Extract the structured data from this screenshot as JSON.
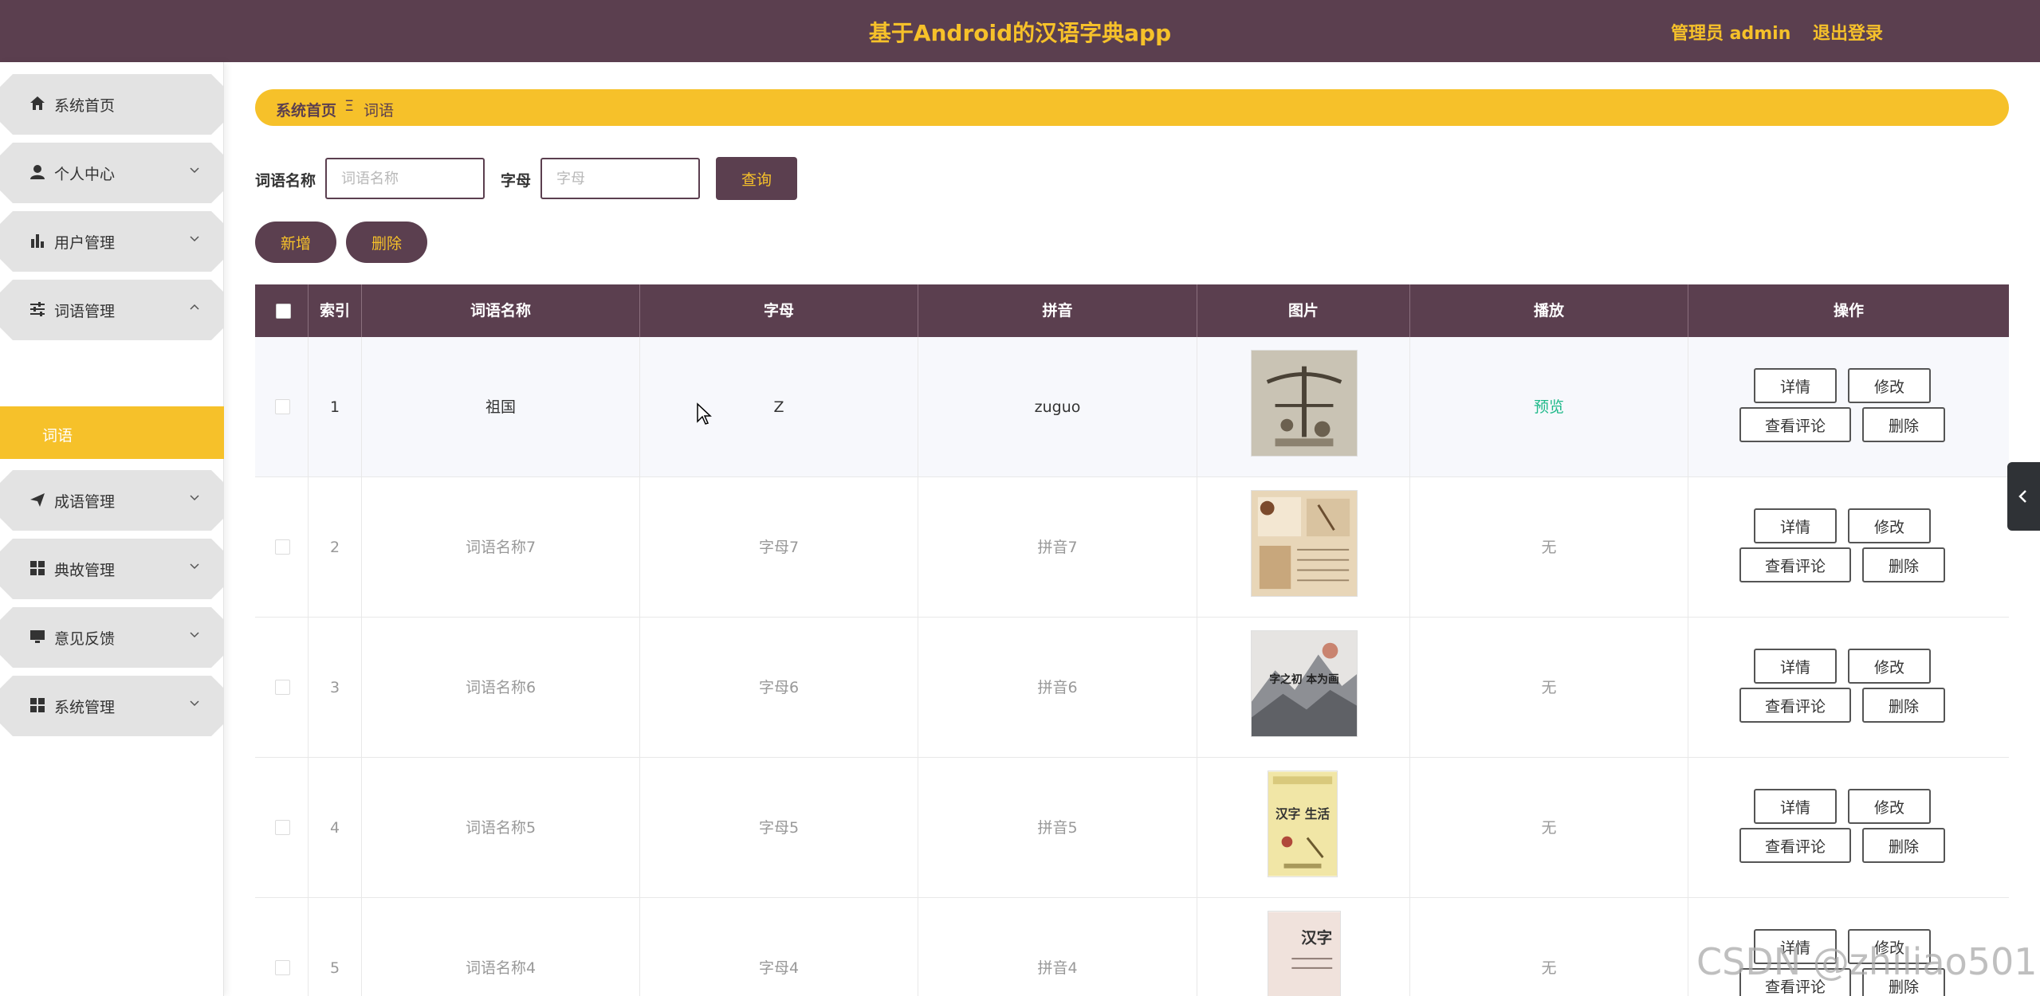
{
  "header": {
    "title": "基于Android的汉语字典app",
    "user": "管理员 admin",
    "logout": "退出登录"
  },
  "sidebar": {
    "items": [
      {
        "label": "系统首页",
        "icon": "home-icon"
      },
      {
        "label": "个人中心",
        "icon": "user-icon"
      },
      {
        "label": "用户管理",
        "icon": "bar-chart-icon"
      },
      {
        "label": "词语管理",
        "icon": "sliders-icon"
      },
      {
        "label": "成语管理",
        "icon": "send-icon"
      },
      {
        "label": "典故管理",
        "icon": "grid-icon"
      },
      {
        "label": "意见反馈",
        "icon": "monitor-icon"
      },
      {
        "label": "系统管理",
        "icon": "grid-icon"
      }
    ],
    "active_sub": "词语"
  },
  "breadcrumb": {
    "home": "系统首页",
    "sep": "Ξ",
    "current": "词语"
  },
  "search": {
    "label1": "词语名称",
    "placeholder1": "词语名称",
    "label2": "字母",
    "placeholder2": "字母",
    "query": "查询"
  },
  "actions": {
    "add": "新增",
    "delete": "删除"
  },
  "table": {
    "headers": [
      "索引",
      "词语名称",
      "字母",
      "拼音",
      "图片",
      "播放",
      "操作"
    ],
    "rows": [
      {
        "index": "1",
        "name": "祖国",
        "letter": "Z",
        "pinyin": "zuguo",
        "play": "预览"
      },
      {
        "index": "2",
        "name": "词语名称7",
        "letter": "字母7",
        "pinyin": "拼音7",
        "play": "无"
      },
      {
        "index": "3",
        "name": "词语名称6",
        "letter": "字母6",
        "pinyin": "拼音6",
        "play": "无"
      },
      {
        "index": "4",
        "name": "词语名称5",
        "letter": "字母5",
        "pinyin": "拼音5",
        "play": "无"
      },
      {
        "index": "5",
        "name": "词语名称4",
        "letter": "字母4",
        "pinyin": "拼音4",
        "play": "无"
      }
    ],
    "ops": {
      "detail": "详情",
      "edit": "修改",
      "comments": "查看评论",
      "delete": "删除"
    },
    "images": [
      {
        "title": "",
        "text": ""
      },
      {
        "title": "",
        "text": ""
      },
      {
        "title": "",
        "text": "字之初 本为画"
      },
      {
        "title": "",
        "text": "汉字 生活"
      },
      {
        "title": "",
        "text": "汉字"
      }
    ]
  },
  "watermark": "CSDN @zhiliao501",
  "colors": {
    "primary": "#5b3f4f",
    "accent": "#f6c12a",
    "link": "#20b98a"
  }
}
